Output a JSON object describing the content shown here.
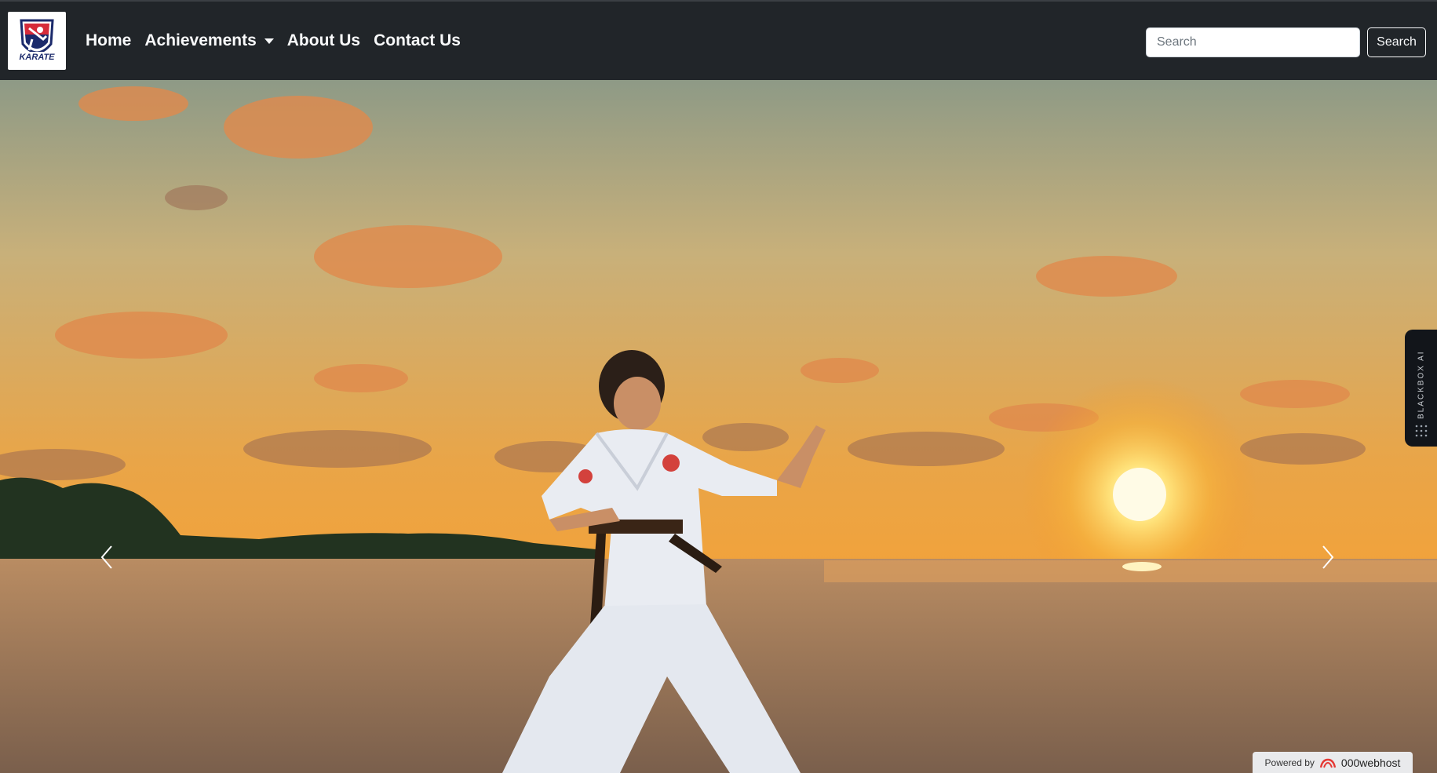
{
  "navbar": {
    "logo_alt": "KARATE",
    "links": [
      {
        "label": "Home"
      },
      {
        "label": "Achievements",
        "dropdown": true
      },
      {
        "label": "About Us"
      },
      {
        "label": "Contact Us"
      }
    ],
    "search": {
      "placeholder": "Search",
      "button_label": "Search"
    }
  },
  "hero": {
    "image": "karate-kid-sunset-beach",
    "prev_icon": "chevron-left-icon",
    "next_icon": "chevron-right-icon"
  },
  "blackbox": {
    "label": "BLACKBOX AI"
  },
  "footer_badge": {
    "prefix": "Powered by",
    "brand": "000webhost"
  },
  "colors": {
    "navbar_bg": "#212529",
    "nav_text": "#f8f9fa",
    "sky_top": "#9aa18a",
    "sky_mid": "#e8a24a",
    "sun": "#fff3b0"
  }
}
